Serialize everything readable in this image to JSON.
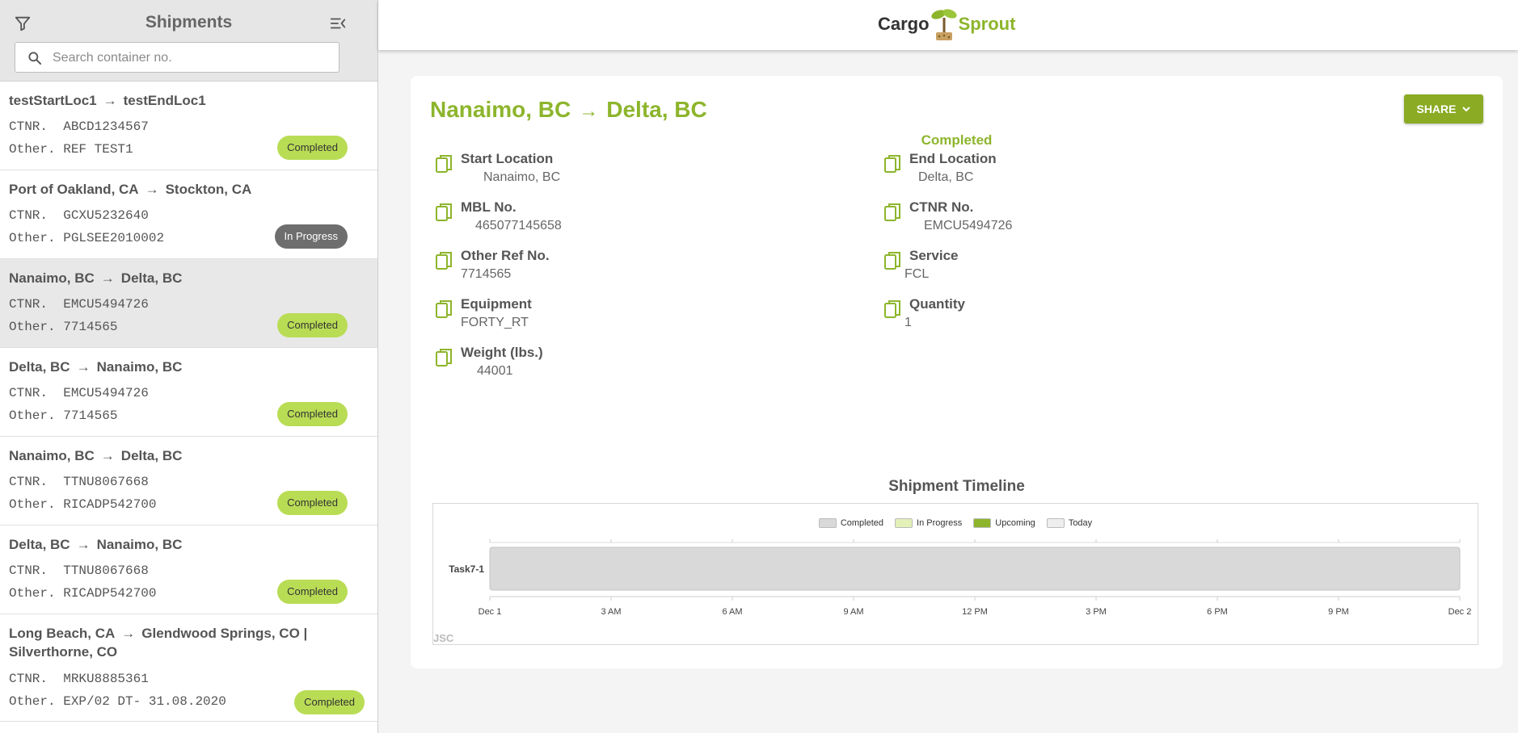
{
  "sidebar": {
    "title": "Shipments",
    "search_placeholder": "Search container no.",
    "items": [
      {
        "from": "testStartLoc1",
        "to": "testEndLoc1",
        "ctnr_label": "CTNR.",
        "ctnr": "ABCD1234567",
        "other_label": "Other.",
        "other": "REF TEST1",
        "status": "Completed"
      },
      {
        "from": "Port of Oakland, CA",
        "to": "Stockton, CA",
        "ctnr_label": "CTNR.",
        "ctnr": "GCXU5232640",
        "other_label": "Other.",
        "other": "PGLSEE2010002",
        "status": "In Progress"
      },
      {
        "from": "Nanaimo, BC",
        "to": "Delta, BC",
        "ctnr_label": "CTNR.",
        "ctnr": "EMCU5494726",
        "other_label": "Other.",
        "other": "7714565",
        "status": "Completed"
      },
      {
        "from": "Delta, BC",
        "to": "Nanaimo, BC",
        "ctnr_label": "CTNR.",
        "ctnr": "EMCU5494726",
        "other_label": "Other.",
        "other": "7714565",
        "status": "Completed"
      },
      {
        "from": "Nanaimo, BC",
        "to": "Delta, BC",
        "ctnr_label": "CTNR.",
        "ctnr": "TTNU8067668",
        "other_label": "Other.",
        "other": "RICADP542700",
        "status": "Completed"
      },
      {
        "from": "Delta, BC",
        "to": "Nanaimo, BC",
        "ctnr_label": "CTNR.",
        "ctnr": "TTNU8067668",
        "other_label": "Other.",
        "other": "RICADP542700",
        "status": "Completed"
      },
      {
        "from": "Long Beach, CA",
        "to": "Glendwood Springs, CO | Silverthorne, CO",
        "ctnr_label": "CTNR.",
        "ctnr": "MRKU8885361",
        "other_label": "Other.",
        "other": "EXP/02 DT- 31.08.2020",
        "status": "Completed"
      }
    ]
  },
  "brand": {
    "word1": "Cargo",
    "word2": "Sprout"
  },
  "detail": {
    "from": "Nanaimo, BC",
    "to": "Delta, BC",
    "status": "Completed",
    "share_label": "SHARE",
    "fields": [
      {
        "label": "Start Location",
        "value": "Nanaimo, BC"
      },
      {
        "label": "End Location",
        "value": "Delta, BC"
      },
      {
        "label": "MBL No.",
        "value": "465077145658"
      },
      {
        "label": "CTNR No.",
        "value": "EMCU5494726"
      },
      {
        "label": "Other Ref No.",
        "value": "7714565"
      },
      {
        "label": "Service",
        "value": "FCL"
      },
      {
        "label": "Equipment",
        "value": "FORTY_RT"
      },
      {
        "label": "Quantity",
        "value": "1"
      },
      {
        "label": "Weight (lbs.)",
        "value": "44001"
      }
    ],
    "timeline_title": "Shipment Timeline"
  },
  "colors": {
    "accent": "#8db52c",
    "completed_badge": "#b9dc55",
    "in_progress_badge": "#6e6e6e"
  },
  "chart_data": {
    "type": "bar",
    "categories": [
      "Task7-1"
    ],
    "legend": [
      {
        "name": "Completed",
        "color": "#d9d9d9"
      },
      {
        "name": "In Progress",
        "color": "#e3f0b8"
      },
      {
        "name": "Upcoming",
        "color": "#8db52c"
      },
      {
        "name": "Today",
        "color": "#eeeeee"
      }
    ],
    "x_ticks": [
      "Dec 1",
      "3 AM",
      "6 AM",
      "9 AM",
      "12 PM",
      "3 PM",
      "6 PM",
      "9 PM",
      "Dec 2"
    ],
    "tasks": [
      {
        "name": "Task7-1",
        "start": "Dec 1",
        "end": "Dec 2",
        "state": "Completed"
      }
    ],
    "watermark": "JSC"
  }
}
